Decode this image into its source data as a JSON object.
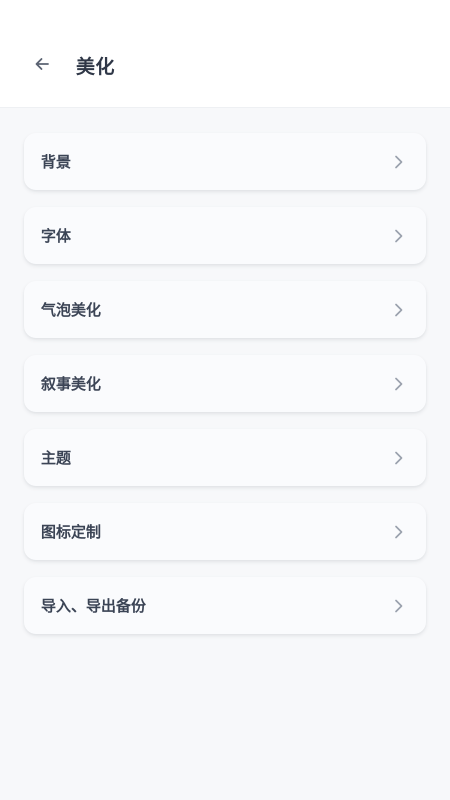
{
  "header": {
    "back_icon": "arrow-left-icon",
    "title": "美化"
  },
  "menu": {
    "items": [
      {
        "label": "背景",
        "icon": "chevron-right-icon"
      },
      {
        "label": "字体",
        "icon": "chevron-right-icon"
      },
      {
        "label": "气泡美化",
        "icon": "chevron-right-icon"
      },
      {
        "label": "叙事美化",
        "icon": "chevron-right-icon"
      },
      {
        "label": "主题",
        "icon": "chevron-right-icon"
      },
      {
        "label": "图标定制",
        "icon": "chevron-right-icon"
      },
      {
        "label": "导入、导出备份",
        "icon": "chevron-right-icon"
      }
    ]
  },
  "colors": {
    "background": "#f7f8fa",
    "header_background": "#ffffff",
    "card_background": "#fafbfd",
    "title_text": "#2f3747",
    "item_text": "#3b4455",
    "chevron": "#9aa1ad"
  }
}
